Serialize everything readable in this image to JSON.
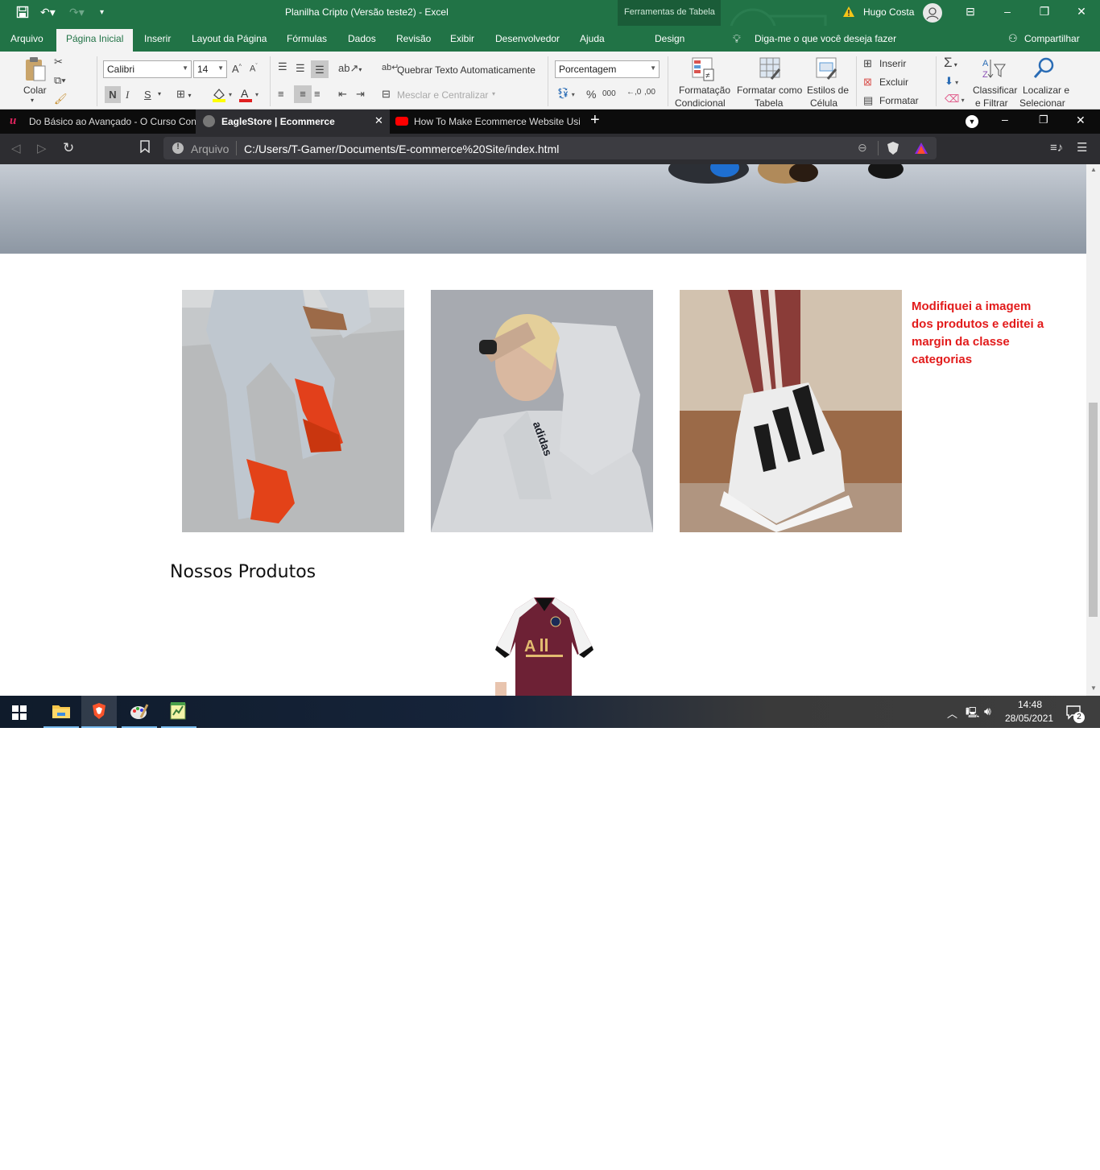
{
  "excel": {
    "title": "Planilha Cripto (Versão teste2)  -  Excel",
    "context_tab": "Ferramentas de Tabela",
    "user": "Hugo Costa",
    "tabs": [
      "Arquivo",
      "Página Inicial",
      "Inserir",
      "Layout da Página",
      "Fórmulas",
      "Dados",
      "Revisão",
      "Exibir",
      "Desenvolvedor",
      "Ajuda",
      "Design"
    ],
    "tell_me": "Diga-me o que você deseja fazer",
    "share": "Compartilhar",
    "ribbon": {
      "paste": "Colar",
      "font_name": "Calibri",
      "font_size": "14",
      "bold": "N",
      "italic": "I",
      "underline": "S",
      "wrap_text": "Quebrar Texto Automaticamente",
      "merge_center": "Mesclar e Centralizar",
      "number_format": "Porcentagem",
      "percent": "%",
      "thousands": "000",
      "cond_format_1": "Formatação",
      "cond_format_2": "Condicional",
      "format_table_1": "Formatar como",
      "format_table_2": "Tabela",
      "cell_styles_1": "Estilos de",
      "cell_styles_2": "Célula",
      "insert": "Inserir",
      "delete": "Excluir",
      "format": "Formatar",
      "sort_1": "Classificar",
      "sort_2": "e Filtrar",
      "find_1": "Localizar e",
      "find_2": "Selecionar"
    }
  },
  "browser": {
    "tabs": [
      {
        "label": "Do Básico ao Avançado - O Curso Con"
      },
      {
        "label": "EagleStore | Ecommerce"
      },
      {
        "label": "How To Make Ecommerce Website Usi"
      }
    ],
    "url_prefix": "Arquivo",
    "url": "C:/Users/T-Gamer/Documents/E-commerce%20Site/index.html"
  },
  "page": {
    "note": "Modifiquei a imagem dos produtos e editei a margin da classe categorias",
    "products_heading": "Nossos Produtos"
  },
  "taskbar": {
    "time": "14:48",
    "date": "28/05/2021",
    "notifications": "2"
  },
  "colors": {
    "excel_green": "#217346",
    "note_red": "#e21b1b"
  }
}
